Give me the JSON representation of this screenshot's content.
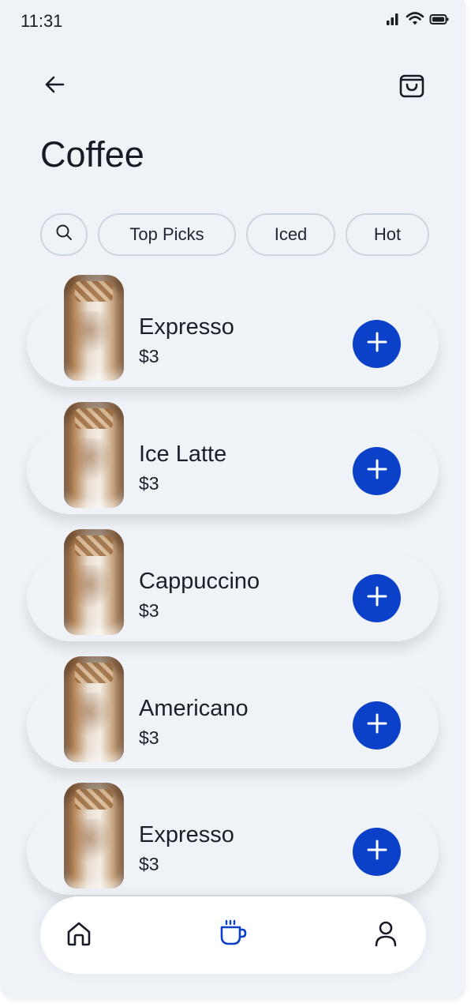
{
  "status_bar": {
    "time": "11:31",
    "icons": [
      "signal-icon",
      "wifi-icon",
      "battery-icon"
    ]
  },
  "header": {
    "back_icon": "arrow-left-icon",
    "cart_icon": "shopping-bag-icon",
    "title": "Coffee"
  },
  "filters": {
    "search_icon": "search-icon",
    "chips": [
      {
        "label": "Top Picks"
      },
      {
        "label": "Iced"
      },
      {
        "label": "Hot"
      }
    ]
  },
  "products": [
    {
      "name": "Expresso",
      "price": "$3",
      "image": "iced-coffee-glass"
    },
    {
      "name": "Ice Latte",
      "price": "$3",
      "image": "iced-coffee-glass"
    },
    {
      "name": "Cappuccino",
      "price": "$3",
      "image": "iced-coffee-glass"
    },
    {
      "name": "Americano",
      "price": "$3",
      "image": "iced-coffee-glass"
    },
    {
      "name": "Expresso",
      "price": "$3",
      "image": "iced-coffee-glass"
    }
  ],
  "bottom_nav": {
    "items": [
      {
        "icon": "home-icon",
        "active": false
      },
      {
        "icon": "coffee-cup-icon",
        "active": true
      },
      {
        "icon": "user-icon",
        "active": false
      }
    ]
  },
  "colors": {
    "background": "#eff3f8",
    "accent": "#0b41c8",
    "text": "#1b1f2a",
    "chip_border": "#cdd5e1",
    "nav_background": "#ffffff"
  }
}
